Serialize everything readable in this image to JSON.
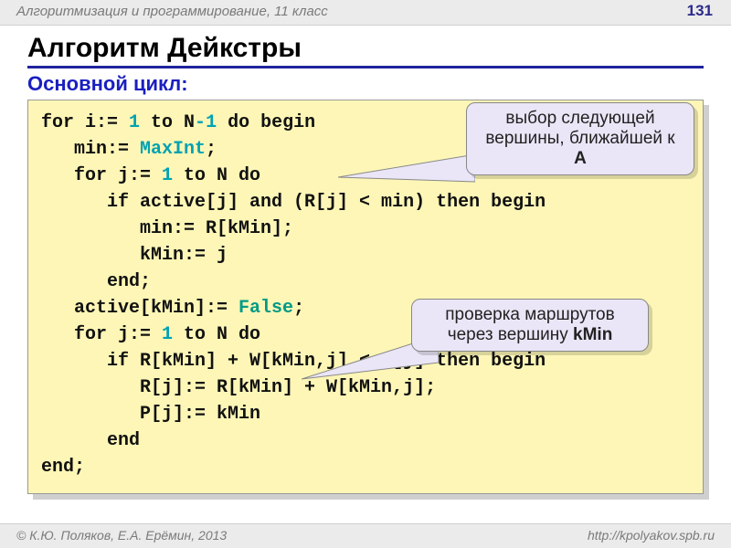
{
  "header": {
    "course": "Алгоритмизация и программирование, 11 класс",
    "page": "131"
  },
  "title": "Алгоритм Дейкстры",
  "subtitle": "Основной цикл:",
  "code": {
    "l1a": "for i:= ",
    "l1b": "1",
    "l1c": " to N",
    "l1d": "-",
    "l1e": "1",
    "l1f": " do begin",
    "l2a": "   min:= ",
    "l2b": "MaxInt",
    "l2c": ";",
    "l3a": "   for j:= ",
    "l3b": "1",
    "l3c": " to N do",
    "l4": "      if active[j] and (R[j] < min) then begin",
    "l5": "         min:= R[kMin];",
    "l6": "         kMin:= j",
    "l7": "      end;",
    "l8a": "   active[kMin]:= ",
    "l8b": "False",
    "l8c": ";",
    "l9a": "   for j:= ",
    "l9b": "1",
    "l9c": " to N do",
    "l10": "      if R[kMin] + W[kMin,j] < R[j] then begin",
    "l11": "         R[j]:= R[kMin] + W[kMin,j];",
    "l12": "         P[j]:= kMin",
    "l13": "      end",
    "l14": "end;"
  },
  "callouts": {
    "c1_text": "выбор следующей вершины, ближайшей к ",
    "c1_bold": "A",
    "c2_text": "проверка маршрутов через вершину ",
    "c2_bold": "kMin"
  },
  "footer": {
    "left": "© К.Ю. Поляков, Е.А. Ерёмин, 2013",
    "right": "http://kpolyakov.spb.ru"
  }
}
